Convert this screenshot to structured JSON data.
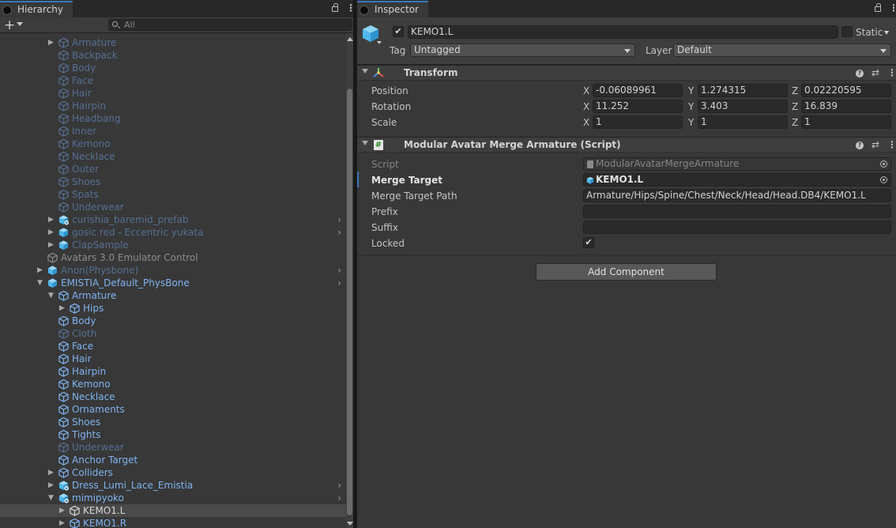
{
  "hierarchy": {
    "tab_label": "Hierarchy",
    "add_label": "+",
    "search_placeholder": "All",
    "rows": [
      {
        "label": "Armature",
        "indent": 2,
        "arrow": "right",
        "color": "dim",
        "icon": "cube-outline-icon",
        "expand": false
      },
      {
        "label": "Backpack",
        "indent": 2,
        "arrow": "",
        "color": "dim",
        "icon": "cube-outline-icon",
        "expand": false
      },
      {
        "label": "Body",
        "indent": 2,
        "arrow": "",
        "color": "dim",
        "icon": "cube-outline-icon",
        "expand": false
      },
      {
        "label": "Face",
        "indent": 2,
        "arrow": "",
        "color": "dim",
        "icon": "cube-outline-icon",
        "expand": false
      },
      {
        "label": "Hair",
        "indent": 2,
        "arrow": "",
        "color": "dim",
        "icon": "cube-outline-icon",
        "expand": false
      },
      {
        "label": "Hairpin",
        "indent": 2,
        "arrow": "",
        "color": "dim",
        "icon": "cube-outline-icon",
        "expand": false
      },
      {
        "label": "Headbang",
        "indent": 2,
        "arrow": "",
        "color": "dim",
        "icon": "cube-outline-icon",
        "expand": false
      },
      {
        "label": "Inner",
        "indent": 2,
        "arrow": "",
        "color": "dim",
        "icon": "cube-outline-icon",
        "expand": false
      },
      {
        "label": "Kemono",
        "indent": 2,
        "arrow": "",
        "color": "dim",
        "icon": "cube-outline-icon",
        "expand": false
      },
      {
        "label": "Necklace",
        "indent": 2,
        "arrow": "",
        "color": "dim",
        "icon": "cube-outline-icon",
        "expand": false
      },
      {
        "label": "Outer",
        "indent": 2,
        "arrow": "",
        "color": "dim",
        "icon": "cube-outline-icon",
        "expand": false
      },
      {
        "label": "Shoes",
        "indent": 2,
        "arrow": "",
        "color": "dim",
        "icon": "cube-outline-icon",
        "expand": false
      },
      {
        "label": "Spats",
        "indent": 2,
        "arrow": "",
        "color": "dim",
        "icon": "cube-outline-icon",
        "expand": false
      },
      {
        "label": "Underwear",
        "indent": 2,
        "arrow": "",
        "color": "dim",
        "icon": "cube-outline-icon",
        "expand": false
      },
      {
        "label": "curishia_baremid_prefab",
        "indent": 2,
        "arrow": "right",
        "color": "dim",
        "icon": "prefab-variant-icon",
        "expand": true
      },
      {
        "label": "gosic red - Eccentric yukata",
        "indent": 2,
        "arrow": "right",
        "color": "dim",
        "icon": "prefab-icon",
        "expand": true
      },
      {
        "label": "ClapSample",
        "indent": 2,
        "arrow": "right",
        "color": "dim",
        "icon": "prefab-icon",
        "expand": false
      },
      {
        "label": "Avatars 3.0 Emulator Control",
        "indent": 1,
        "arrow": "",
        "color": "grey",
        "icon": "cube-outline-icon",
        "expand": false
      },
      {
        "label": "Anon(Physbone)",
        "indent": 1,
        "arrow": "right",
        "color": "dim",
        "icon": "prefab-icon",
        "expand": true
      },
      {
        "label": "EMISTIA_Default_PhysBone",
        "indent": 1,
        "arrow": "down",
        "color": "blue",
        "icon": "prefab-icon",
        "expand": true
      },
      {
        "label": "Armature",
        "indent": 2,
        "arrow": "down",
        "color": "blue",
        "icon": "cube-outline-icon",
        "expand": false
      },
      {
        "label": "Hips",
        "indent": 3,
        "arrow": "right",
        "color": "blue",
        "icon": "cube-outline-icon",
        "expand": false
      },
      {
        "label": "Body",
        "indent": 2,
        "arrow": "",
        "color": "blue",
        "icon": "cube-outline-icon",
        "expand": false
      },
      {
        "label": "Cloth",
        "indent": 2,
        "arrow": "",
        "color": "dim",
        "icon": "cube-outline-icon",
        "expand": false
      },
      {
        "label": "Face",
        "indent": 2,
        "arrow": "",
        "color": "blue",
        "icon": "cube-outline-icon",
        "expand": false
      },
      {
        "label": "Hair",
        "indent": 2,
        "arrow": "",
        "color": "blue",
        "icon": "cube-outline-icon",
        "expand": false
      },
      {
        "label": "Hairpin",
        "indent": 2,
        "arrow": "",
        "color": "blue",
        "icon": "cube-outline-icon",
        "expand": false
      },
      {
        "label": "Kemono",
        "indent": 2,
        "arrow": "",
        "color": "blue",
        "icon": "cube-outline-icon",
        "expand": false
      },
      {
        "label": "Necklace",
        "indent": 2,
        "arrow": "",
        "color": "blue",
        "icon": "cube-outline-icon",
        "expand": false
      },
      {
        "label": "Ornaments",
        "indent": 2,
        "arrow": "",
        "color": "blue",
        "icon": "cube-outline-icon",
        "expand": false
      },
      {
        "label": "Shoes",
        "indent": 2,
        "arrow": "",
        "color": "blue",
        "icon": "cube-outline-icon",
        "expand": false
      },
      {
        "label": "Tights",
        "indent": 2,
        "arrow": "",
        "color": "blue",
        "icon": "cube-outline-icon",
        "expand": false
      },
      {
        "label": "Underwear",
        "indent": 2,
        "arrow": "",
        "color": "dim",
        "icon": "cube-outline-icon",
        "expand": false
      },
      {
        "label": "Anchor Target",
        "indent": 2,
        "arrow": "",
        "color": "blue",
        "icon": "cube-outline-icon",
        "expand": false
      },
      {
        "label": "Colliders",
        "indent": 2,
        "arrow": "right",
        "color": "blue",
        "icon": "cube-outline-icon",
        "expand": false
      },
      {
        "label": "Dress_Lumi_Lace_Emistia",
        "indent": 2,
        "arrow": "right",
        "color": "blue",
        "icon": "prefab-variant-icon",
        "expand": true
      },
      {
        "label": "mimipyoko",
        "indent": 2,
        "arrow": "down",
        "color": "blue",
        "icon": "prefab-variant-icon",
        "expand": true
      },
      {
        "label": "KEMO1.L",
        "indent": 3,
        "arrow": "right",
        "color": "white",
        "icon": "cube-outline-icon",
        "expand": false,
        "selected": true
      },
      {
        "label": "KEMO1.R",
        "indent": 3,
        "arrow": "right",
        "color": "blue",
        "icon": "cube-outline-icon",
        "expand": false
      }
    ]
  },
  "inspector": {
    "tab_label": "Inspector",
    "object": {
      "name": "KEMO1.L",
      "active": true,
      "static_label": "Static",
      "tag_label": "Tag",
      "tag_value": "Untagged",
      "layer_label": "Layer",
      "layer_value": "Default"
    },
    "transform": {
      "title": "Transform",
      "rows": [
        {
          "label": "Position",
          "x": "-0.06089961",
          "y": "1.274315",
          "z": "0.02220595"
        },
        {
          "label": "Rotation",
          "x": "11.252",
          "y": "3.403",
          "z": "16.839"
        },
        {
          "label": "Scale",
          "x": "1",
          "y": "1",
          "z": "1"
        }
      ],
      "axis_x": "X",
      "axis_y": "Y",
      "axis_z": "Z"
    },
    "merge": {
      "title": "Modular Avatar Merge Armature (Script)",
      "script_label": "Script",
      "script_value": "ModularAvatarMergeArmature",
      "target_label": "Merge Target",
      "target_value": "KEMO1.L",
      "path_label": "Merge Target Path",
      "path_value": "Armature/Hips/Spine/Chest/Neck/Head/Head.DB4/KEMO1.L",
      "prefix_label": "Prefix",
      "prefix_value": "",
      "suffix_label": "Suffix",
      "suffix_value": "",
      "locked_label": "Locked",
      "locked": true
    },
    "add_component_label": "Add Component"
  },
  "colors": {
    "accent": "#3a79bb",
    "hier_blue": "#7fb3f0",
    "hier_dim": "#566e91",
    "cube_blue": "#4fb8ec"
  }
}
